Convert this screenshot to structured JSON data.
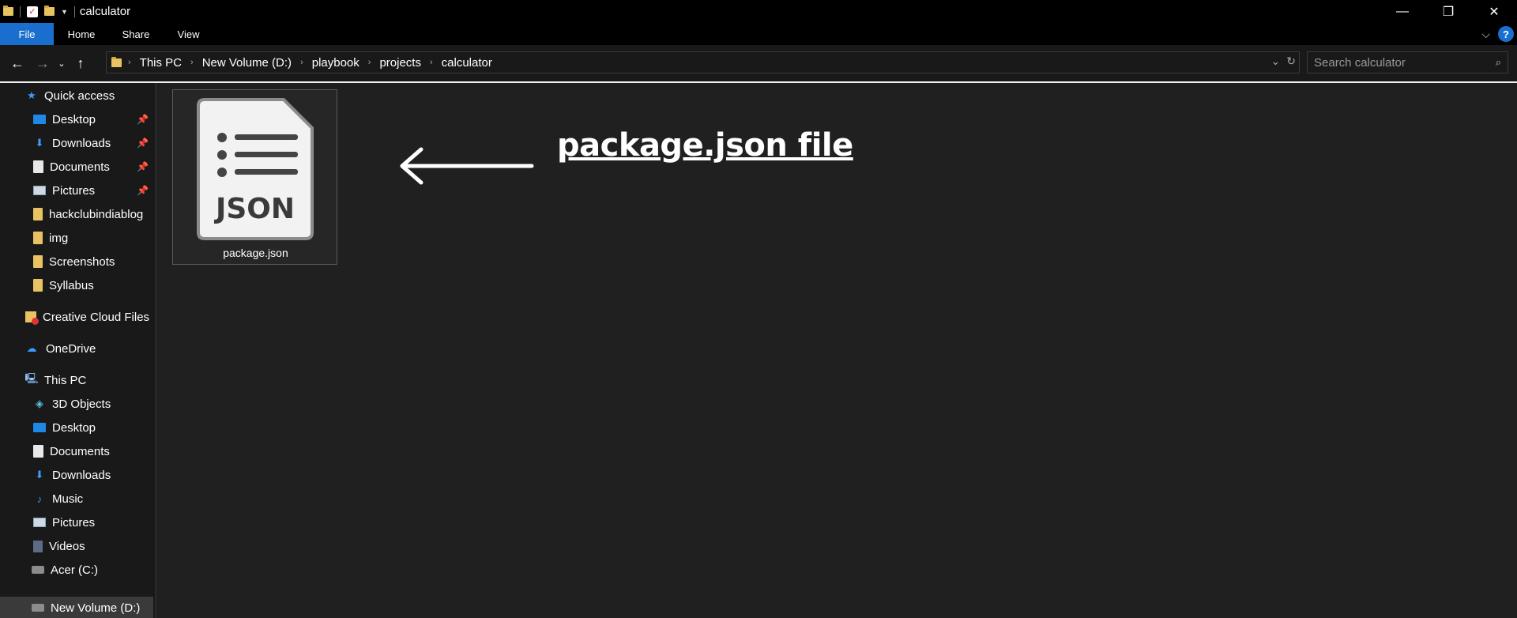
{
  "window": {
    "title": "calculator",
    "controls": {
      "minimize": "—",
      "maximize": "❐",
      "close": "✕"
    }
  },
  "ribbon": {
    "tabs": [
      "File",
      "Home",
      "Share",
      "View"
    ],
    "help": "?"
  },
  "address": {
    "crumbs": [
      "This PC",
      "New Volume (D:)",
      "playbook",
      "projects",
      "calculator"
    ]
  },
  "search": {
    "placeholder": "Search calculator"
  },
  "sidebar": {
    "quick_access": "Quick access",
    "quick_items": [
      "Desktop",
      "Downloads",
      "Documents",
      "Pictures",
      "hackclubindiablog",
      "img",
      "Screenshots",
      "Syllabus"
    ],
    "creative_cloud": "Creative Cloud Files",
    "onedrive": "OneDrive",
    "this_pc": "This PC",
    "pc_items": [
      "3D Objects",
      "Desktop",
      "Documents",
      "Downloads",
      "Music",
      "Pictures",
      "Videos",
      "Acer (C:)",
      "New Volume (D:)"
    ]
  },
  "content": {
    "file_name": "package.json",
    "file_icon_text": "JSON",
    "annotation": "package.json file"
  },
  "colors": {
    "accent": "#1a6fce",
    "background": "#202020",
    "sidebar": "#191919",
    "folder": "#e9c261"
  }
}
